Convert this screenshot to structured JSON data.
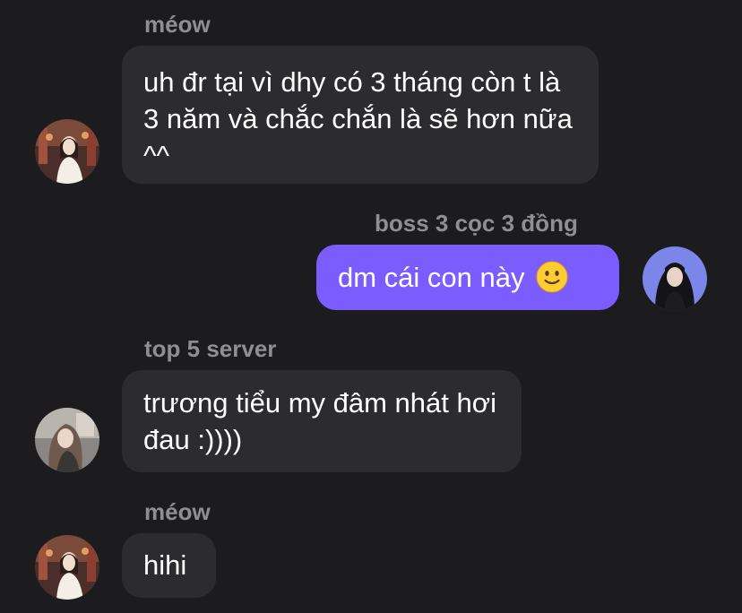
{
  "messages": [
    {
      "sender": "méow",
      "direction": "incoming",
      "text": "uh đr tại vì dhy có 3 tháng còn t là 3 năm và chắc chắn là sẽ hơn nữa ^^",
      "avatar_icon": "profile-photo-meow"
    },
    {
      "sender": "boss 3 cọc 3 đồng",
      "direction": "outgoing",
      "text": "dm cái con này",
      "emoji": "slightly-smiling-face-icon",
      "avatar_icon": "profile-photo-boss"
    },
    {
      "sender": "top 5 server",
      "direction": "incoming",
      "text": "trương tiểu my đâm nhát hơi đau :))))",
      "avatar_icon": "profile-photo-top5"
    },
    {
      "sender": "méow",
      "direction": "incoming",
      "text": "hihi",
      "avatar_icon": "profile-photo-meow"
    }
  ],
  "colors": {
    "background": "#1c1c1e",
    "incoming_bubble": "#2c2c2e",
    "outgoing_bubble": "#7a5cff",
    "sender_name": "#8e8e93",
    "message_text": "#ffffff"
  }
}
